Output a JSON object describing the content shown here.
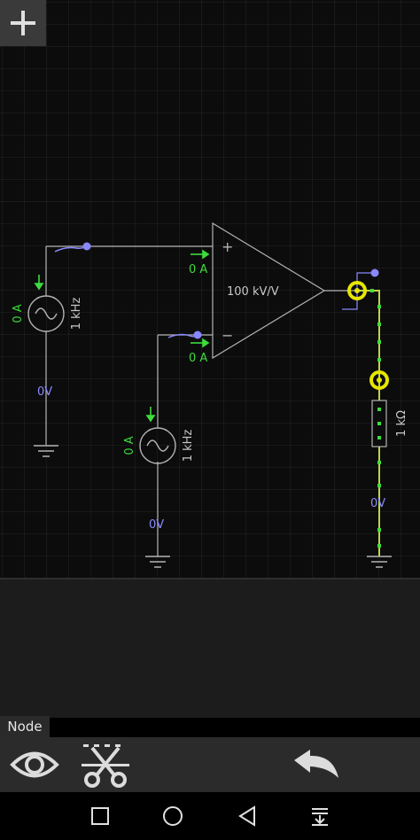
{
  "circuit": {
    "source_top": {
      "current": "0 A",
      "frequency": "1 kHz",
      "voltage": "0V"
    },
    "source_bottom": {
      "current": "0 A",
      "frequency": "1 kHz",
      "voltage": "0V"
    },
    "opamp": {
      "gain": "100 kV/V",
      "plus_symbol": "+",
      "minus_symbol": "−",
      "in_plus_current": "0 A",
      "in_minus_current": "0 A"
    },
    "resistor": {
      "value": "1 kΩ",
      "voltage": "0V"
    }
  },
  "panel": {
    "selection_label": "Node"
  },
  "toolbar": {
    "eye_icon": "eye-icon",
    "cut_icon": "scissors-icon",
    "undo_icon": "undo-icon"
  },
  "navbar": {
    "recent_icon": "square-icon",
    "home_icon": "circle-icon",
    "back_icon": "triangle-back-icon",
    "menu_icon": "notification-menu-icon"
  },
  "colors": {
    "wire": "#b3b3b3",
    "current_arrow": "#3ddc3d",
    "voltage_label": "#8a8aff",
    "node_dot": "#8888ff",
    "selected_node": "#e6e600",
    "highlight_wire": "#bcd64a"
  }
}
